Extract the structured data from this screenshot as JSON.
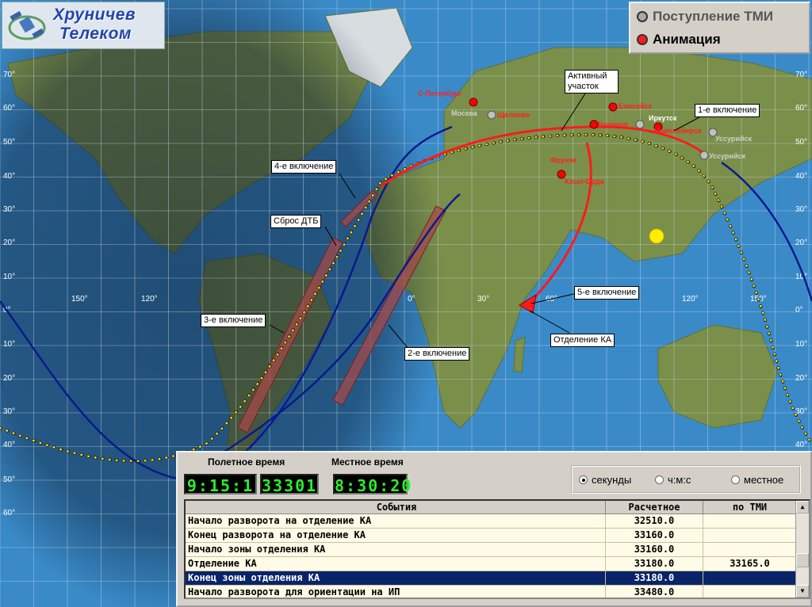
{
  "logo": {
    "line1": "Хруничев",
    "line2": "Телеком"
  },
  "legend": {
    "tmi_label": "Поступление ТМИ",
    "animation_label": "Анимация"
  },
  "map": {
    "lat_labels": [
      "70°",
      "60°",
      "50°",
      "40°",
      "30°",
      "20°",
      "10°",
      "0°",
      "10°",
      "20°",
      "30°",
      "40°",
      "50°",
      "60°"
    ],
    "lon_labels": [
      "150°",
      "120°",
      "0°",
      "30°",
      "60°",
      "120°",
      "150°"
    ],
    "cities": [
      "С-Петербург",
      "Москва",
      "Щелково",
      "Енисейск",
      "Иркутск",
      "Барнаул",
      "Новосибирск",
      "Уссурийск",
      "Уссурийск",
      "Фрунзе",
      "Кзыл-Орда"
    ],
    "callouts": {
      "active_segment": "Активный участок",
      "burn1": "1-е включение",
      "burn2": "2-е включение",
      "burn3": "3-е включение",
      "burn4": "4-е включение",
      "burn5": "5-е включение",
      "dtb": "Сброс ДТБ",
      "separation": "Отделение КА"
    },
    "colors": {
      "orbit": "#0a1a8c",
      "active_track": "#ff1a1a",
      "sun": "#ffee00",
      "burn_band": "#b05050"
    }
  },
  "panel": {
    "flight_time_label": "Полетное время",
    "local_time_label": "Местное время",
    "flight_time_hms": "9:15:1",
    "flight_time_sec": "33301",
    "local_time": "8:30:20",
    "radios": [
      {
        "label": "секунды",
        "selected": true
      },
      {
        "label": "ч:м:с",
        "selected": false
      },
      {
        "label": "местное",
        "selected": false
      }
    ],
    "table": {
      "headers": [
        "События",
        "Расчетное",
        "по ТМИ"
      ],
      "rows": [
        {
          "event": "Начало разворота на отделение КА",
          "calc": "32510.0",
          "tmi": "",
          "selected": false
        },
        {
          "event": "Конец разворота на отделение КА",
          "calc": "33160.0",
          "tmi": "",
          "selected": false
        },
        {
          "event": "Начало зоны отделения КА",
          "calc": "33160.0",
          "tmi": "",
          "selected": false
        },
        {
          "event": "Отделение КА",
          "calc": "33180.0",
          "tmi": "33165.0",
          "selected": false
        },
        {
          "event": "Конец зоны отделения КА",
          "calc": "33180.0",
          "tmi": "",
          "selected": true
        },
        {
          "event": "Начало разворота для ориентации на ИП",
          "calc": "33480.0",
          "tmi": "",
          "selected": false
        }
      ]
    }
  }
}
